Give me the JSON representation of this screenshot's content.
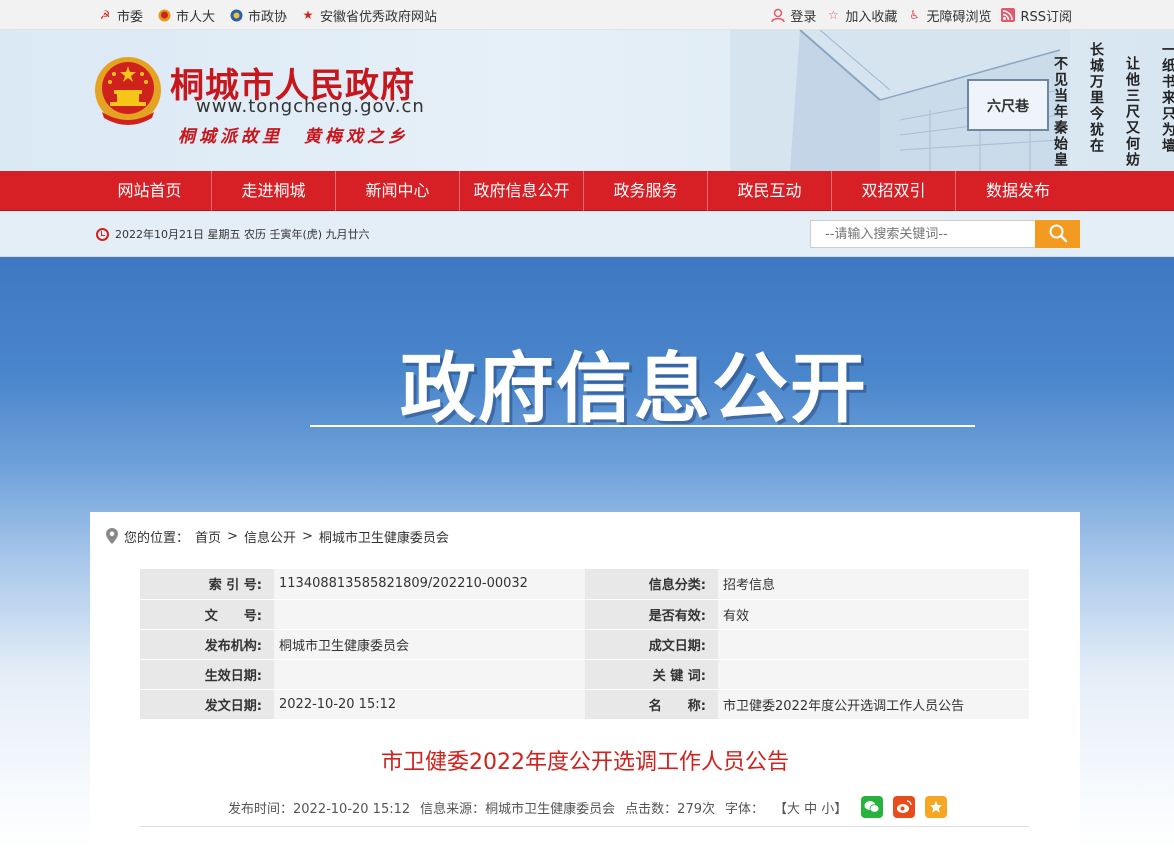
{
  "topbar": {
    "left": [
      {
        "label": "市委",
        "icon": "party-emblem-icon"
      },
      {
        "label": "市人大",
        "icon": "national-emblem-icon"
      },
      {
        "label": "市政协",
        "icon": "cppcc-emblem-icon"
      },
      {
        "label": "安徽省优秀政府网站",
        "icon": "star-icon"
      }
    ],
    "right": [
      {
        "label": "登录",
        "icon": "user-icon"
      },
      {
        "label": "加入收藏",
        "icon": "star-outline-icon"
      },
      {
        "label": "无障碍浏览",
        "icon": "accessibility-icon"
      },
      {
        "label": "RSS订阅",
        "icon": "rss-icon"
      }
    ]
  },
  "header": {
    "title": "桐城市人民政府",
    "url": "www.tongcheng.gov.cn",
    "slogan": "桐城派故里　黄梅戏之乡",
    "poem": [
      "一纸书来只为墙",
      "让他三尺又何妨",
      "长城万里今犹在",
      "不见当年秦始皇"
    ],
    "plaque": "六尺巷"
  },
  "nav": [
    "网站首页",
    "走进桐城",
    "新闻中心",
    "政府信息公开",
    "政务服务",
    "政民互动",
    "双招双引",
    "数据发布"
  ],
  "infobar": {
    "date": "2022年10月21日 星期五 农历 壬寅年(虎) 九月廿六",
    "search_placeholder": "--请输入搜索关键词--"
  },
  "banner": {
    "title": "政府信息公开"
  },
  "breadcrumb": {
    "prefix": "您的位置：",
    "items": [
      "首页",
      "信息公开",
      "桐城市卫生健康委员会"
    ],
    "separator": ">"
  },
  "meta": [
    {
      "k1": "索 引 号:",
      "v1": "113408813585821809/202210-00032",
      "k2": "信息分类:",
      "v2": "招考信息"
    },
    {
      "k1": "文　　号:",
      "v1": "",
      "k2": "是否有效:",
      "v2": "有效"
    },
    {
      "k1": "发布机构:",
      "v1": "桐城市卫生健康委员会",
      "k2": "成文日期:",
      "v2": ""
    },
    {
      "k1": "生效日期:",
      "v1": "",
      "k2": "关 键 词:",
      "v2": ""
    },
    {
      "k1": "发文日期:",
      "v1": "2022-10-20 15:12",
      "k2": "名　　称:",
      "v2": "市卫健委2022年度公开选调工作人员公告"
    }
  ],
  "article": {
    "title": "市卫健委2022年度公开选调工作人员公告",
    "pub_time": "发布时间：2022-10-20 15:12",
    "source": "信息来源：桐城市卫生健康委员会",
    "clicks": "点击数：279次",
    "font_label": "字体：",
    "font_sizes": "【大 中 小】"
  },
  "colors": {
    "brand_red": "#d71f26",
    "title_red": "#c8161d",
    "search_orange": "#f39a21",
    "banner_blue": "#4a86cc"
  }
}
